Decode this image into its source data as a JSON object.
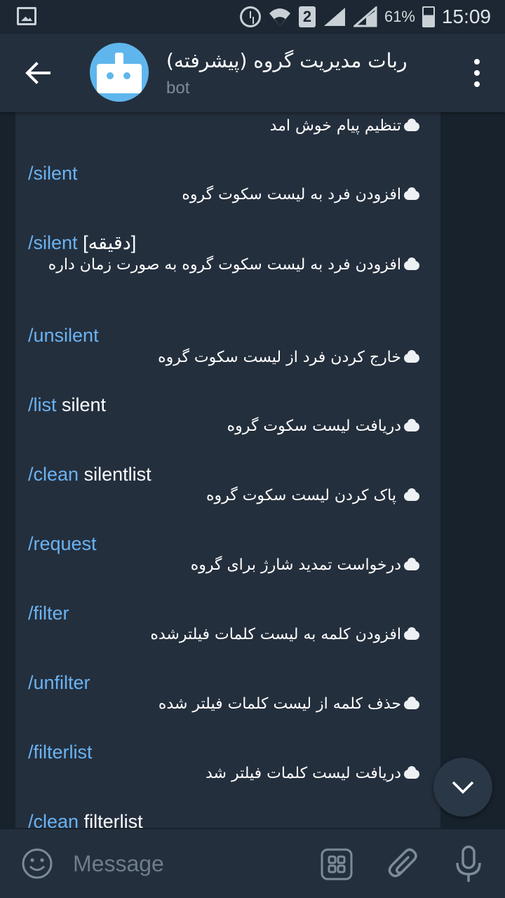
{
  "status_bar": {
    "battery_percent": "61%",
    "sim_slot": "2",
    "time": "15:09"
  },
  "header": {
    "title": "ربات مدیریت گروه (پیشرفته)",
    "subtitle": "bot"
  },
  "messages": [
    {
      "command": "",
      "args": "",
      "description": "تنظیم پیام خوش امد"
    },
    {
      "command": "/silent",
      "args": "",
      "description": "افزودن فرد به لیست سکوت گروه"
    },
    {
      "command": "/silent",
      "args": "[دقیقه]",
      "description": "افزودن فرد به لیست سکوت گروه به صورت زمان داره"
    },
    {
      "command": "/unsilent",
      "args": "",
      "description": "خارج کردن فرد از لیست سکوت گروه"
    },
    {
      "command": "/list",
      "args": "silent",
      "description": "دریافت لیست سکوت گروه"
    },
    {
      "command": "/clean",
      "args": "silentlist",
      "description": " پاک کردن لیست سکوت گروه"
    },
    {
      "command": "/request",
      "args": "",
      "description": "درخواست تمدید شارژ برای گروه"
    },
    {
      "command": "/filter",
      "args": "",
      "description": "افزودن کلمه به لیست کلمات فیلترشده"
    },
    {
      "command": "/unfilter",
      "args": "",
      "description": "حذف کلمه از لیست کلمات فیلتر شده"
    },
    {
      "command": "/filterlist",
      "args": "",
      "description": "دریافت لیست کلمات فیلتر شد"
    },
    {
      "command": "/clean",
      "args": "filterlist",
      "description": ""
    }
  ],
  "input": {
    "placeholder": "Message"
  },
  "colors": {
    "command_link": "#6ab3f3",
    "header_bg": "#242f3d",
    "chat_bg": "#18222d",
    "bubble_bg": "#242f3d"
  },
  "icons": [
    "back-arrow-icon",
    "menu-dots-icon",
    "chevron-down-icon",
    "emoji-icon",
    "bot-commands-icon",
    "paperclip-icon",
    "microphone-icon",
    "thought-balloon-icon"
  ]
}
